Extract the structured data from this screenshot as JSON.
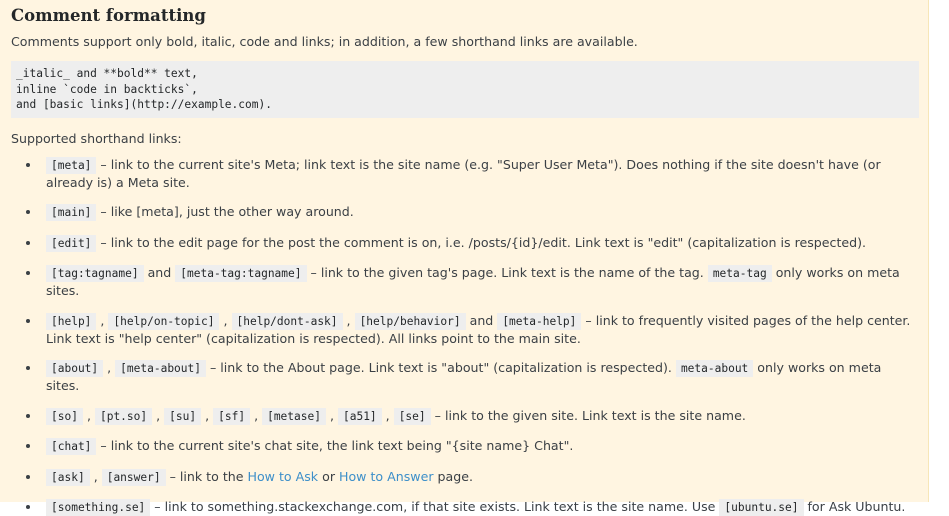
{
  "heading": "Comment formatting",
  "intro": "Comments support only bold, italic, code and links; in addition, a few shorthand links are available.",
  "code_example": "_italic_ and **bold** text,\ninline `code in backticks`,\nand [basic links](http://example.com).",
  "supported_label": "Supported shorthand links:",
  "items": [
    {
      "codes": [
        "[meta]"
      ],
      "text": " – link to the current site's Meta; link text is the site name (e.g. \"Super User Meta\"). Does nothing if the site doesn't have (or already is) a Meta site."
    },
    {
      "codes": [
        "[main]"
      ],
      "text": " – like [meta], just the other way around."
    },
    {
      "codes": [
        "[edit]"
      ],
      "text": " – link to the edit page for the post the comment is on, i.e. /posts/{id}/edit. Link text is \"edit\" (capitalization is respected)."
    },
    {
      "codes": [
        "[tag:tagname]",
        "[meta-tag:tagname]"
      ],
      "join": " and ",
      "text": " – link to the given tag's page. Link text is the name of the tag. ",
      "extra_code": "meta-tag",
      "extra_text": " only works on meta sites."
    },
    {
      "codes": [
        "[help]",
        "[help/on-topic]",
        "[help/dont-ask]",
        "[help/behavior]",
        "[meta-help]"
      ],
      "text": " – link to frequently visited pages of the help center. Link text is \"help center\" (capitalization is respected). All links point to the main site."
    },
    {
      "codes": [
        "[about]",
        "[meta-about]"
      ],
      "text": " – link to the About page. Link text is \"about\" (capitalization is respected). ",
      "extra_code": "meta-about",
      "extra_text": " only works on meta sites."
    },
    {
      "codes": [
        "[so]",
        "[pt.so]",
        "[su]",
        "[sf]",
        "[metase]",
        "[a51]",
        "[se]"
      ],
      "text": " – link to the given site. Link text is the site name."
    },
    {
      "codes": [
        "[chat]"
      ],
      "text": " – link to the current site's chat site, the link text being \"{site name} Chat\"."
    },
    {
      "codes": [
        "[ask]",
        "[answer]"
      ],
      "text_before_link1": " – link to the ",
      "link1": "How to Ask",
      "between": " or ",
      "link2": "How to Answer",
      "text_after": " page."
    },
    {
      "codes": [
        "[something.se]"
      ],
      "text": " – link to something.stackexchange.com, if that site exists. Link text is the site name. Use ",
      "extra_code": "[ubuntu.se]",
      "extra_text": " for Ask Ubuntu."
    }
  ],
  "colors": {
    "panel_bg": "#fff5e1",
    "code_bg": "#eeeeee",
    "link": "#3d8fc9"
  }
}
